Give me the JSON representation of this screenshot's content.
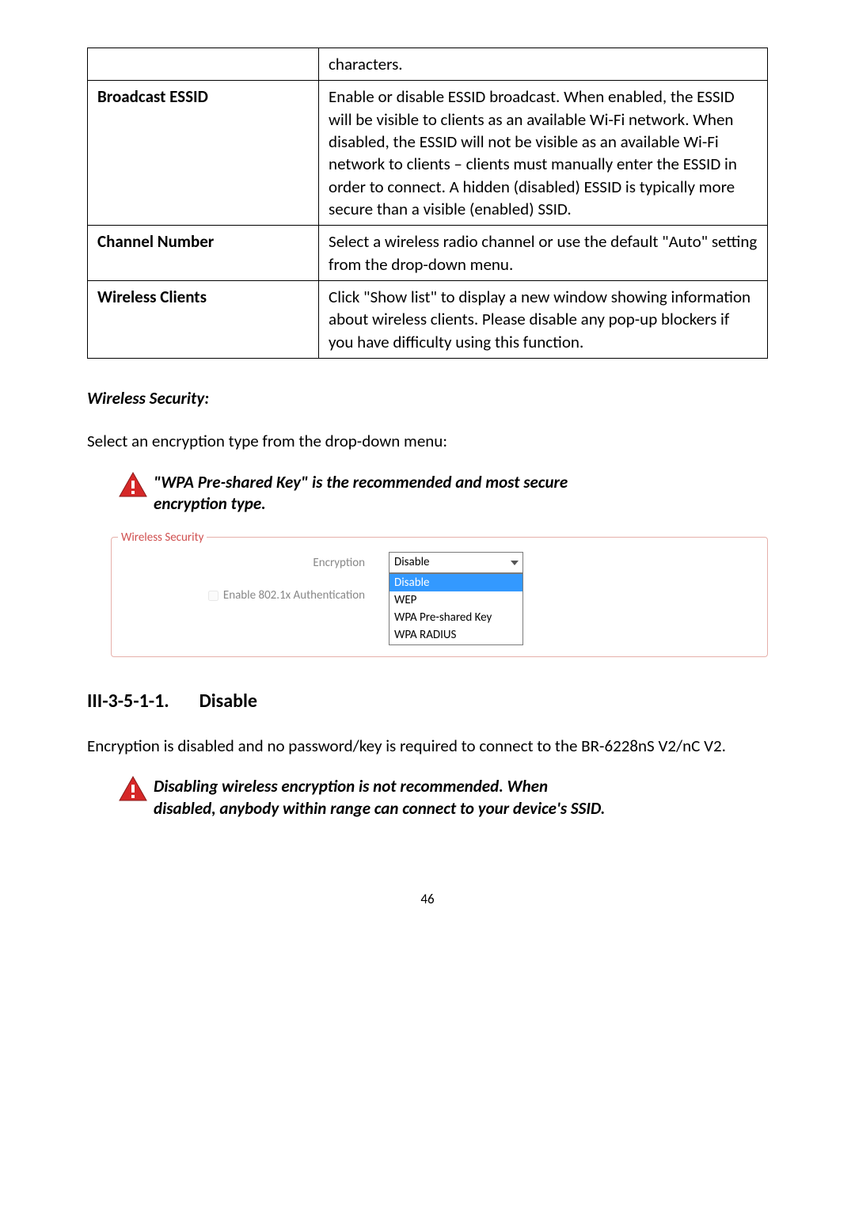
{
  "table": {
    "row1": {
      "label": "",
      "text": "characters."
    },
    "row2": {
      "label": "Broadcast ESSID",
      "text": "Enable or disable ESSID broadcast. When enabled, the ESSID will be visible to clients as an available Wi-Fi network. When disabled, the ESSID will not be visible as an available Wi-Fi network to clients – clients must manually enter the ESSID in order to connect. A hidden (disabled) ESSID is typically more secure than a visible (enabled) SSID."
    },
    "row3": {
      "label": "Channel Number",
      "text": "Select a wireless radio channel or use the default \"Auto\" setting from the drop-down menu."
    },
    "row4": {
      "label": "Wireless Clients",
      "text": "Click \"Show list\" to display a new window showing information about wireless clients. Please disable any pop-up blockers if you have difficulty using this function."
    }
  },
  "sections": {
    "wireless_security_title": "Wireless Security:",
    "select_encryption_para": "Select an encryption type from the drop-down menu:",
    "callout1_line1": "\"WPA Pre-shared Key\" is the recommended and most secure",
    "callout1_line2": "encryption type.",
    "heading_num": "III-3-5-1-1.",
    "heading_text": "Disable",
    "disable_para": "Encryption is disabled and no password/key is required to connect to the BR-6228nS V2/nC V2.",
    "callout2_line1": "Disabling wireless encryption is not recommended. When",
    "callout2_line2": "disabled, anybody within range can connect to your device's SSID."
  },
  "figure": {
    "legend": "Wireless  Security",
    "encryption_label": "Encryption",
    "auth_label": "Enable 802.1x Authentication",
    "dropdown_value": "Disable",
    "options": {
      "opt1": "Disable",
      "opt2": "WEP",
      "opt3": "WPA Pre-shared Key",
      "opt4": "WPA RADIUS"
    }
  },
  "page_number": "46"
}
